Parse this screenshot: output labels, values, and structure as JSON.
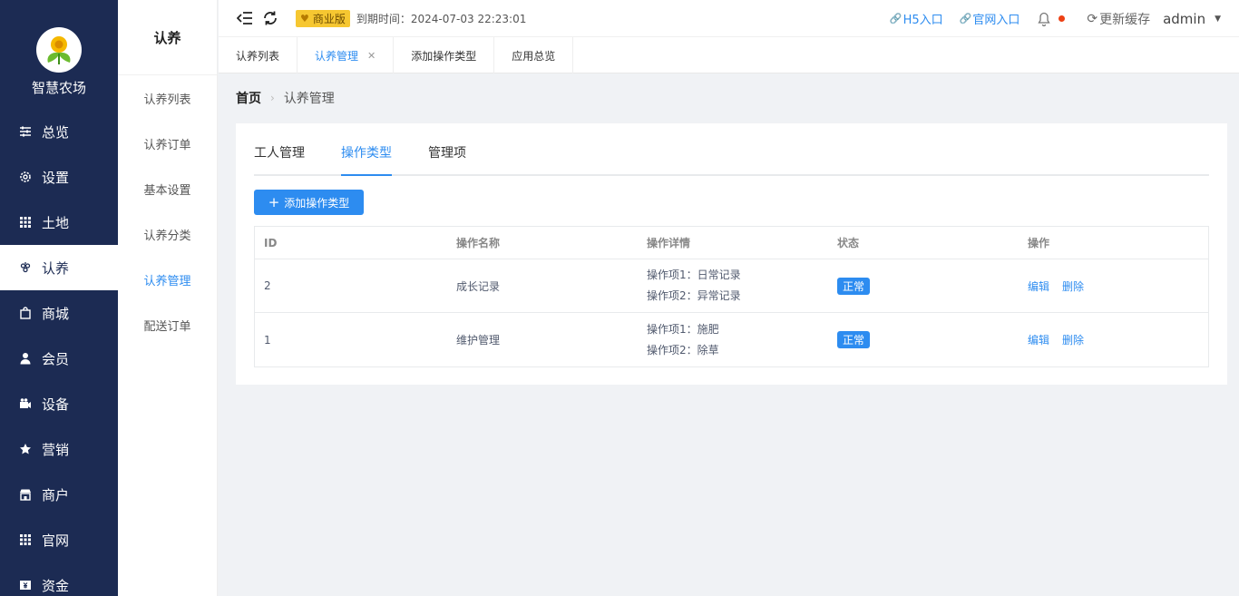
{
  "app": {
    "name": "智慧农场"
  },
  "sidebar": {
    "items": [
      {
        "label": "总览",
        "icon": "sliders-icon"
      },
      {
        "label": "设置",
        "icon": "gear-icon"
      },
      {
        "label": "土地",
        "icon": "grid-icon"
      },
      {
        "label": "认养",
        "icon": "grapes-icon",
        "active": true
      },
      {
        "label": "商城",
        "icon": "shopping-bag-icon"
      },
      {
        "label": "会员",
        "icon": "user-icon"
      },
      {
        "label": "设备",
        "icon": "camera-icon"
      },
      {
        "label": "营销",
        "icon": "star-icon"
      },
      {
        "label": "商户",
        "icon": "store-icon"
      },
      {
        "label": "官网",
        "icon": "grid-icon"
      },
      {
        "label": "资金",
        "icon": "money-icon"
      }
    ]
  },
  "submenu": {
    "title": "认养",
    "items": [
      {
        "label": "认养列表"
      },
      {
        "label": "认养订单"
      },
      {
        "label": "基本设置"
      },
      {
        "label": "认养分类"
      },
      {
        "label": "认养管理",
        "active": true
      },
      {
        "label": "配送订单"
      }
    ]
  },
  "header": {
    "version_badge": "商业版",
    "expire_text": "到期时间：2024-07-03 22:23:01",
    "h5_link": "H5入口",
    "site_link": "官网入口",
    "refresh_label": "更新缓存",
    "user": "admin"
  },
  "tabbar": {
    "tabs": [
      {
        "label": "认养列表"
      },
      {
        "label": "认养管理",
        "active": true,
        "closable": true
      },
      {
        "label": "添加操作类型"
      },
      {
        "label": "应用总览"
      }
    ]
  },
  "breadcrumb": {
    "home": "首页",
    "current": "认养管理"
  },
  "content": {
    "tabs": [
      {
        "label": "工人管理"
      },
      {
        "label": "操作类型",
        "active": true
      },
      {
        "label": "管理项"
      }
    ],
    "add_button": "添加操作类型",
    "table": {
      "columns": [
        "ID",
        "操作名称",
        "操作详情",
        "状态",
        "操作"
      ],
      "rows": [
        {
          "id": "2",
          "name": "成长记录",
          "details": [
            "操作项1：日常记录",
            "操作项2：异常记录"
          ],
          "status": "正常",
          "edit": "编辑",
          "delete": "删除"
        },
        {
          "id": "1",
          "name": "维护管理",
          "details": [
            "操作项1：施肥",
            "操作项2：除草"
          ],
          "status": "正常",
          "edit": "编辑",
          "delete": "删除"
        }
      ]
    }
  },
  "colors": {
    "sidebar_bg": "#1c2b53",
    "accent": "#2d8cf0",
    "badge": "#f6c731"
  }
}
